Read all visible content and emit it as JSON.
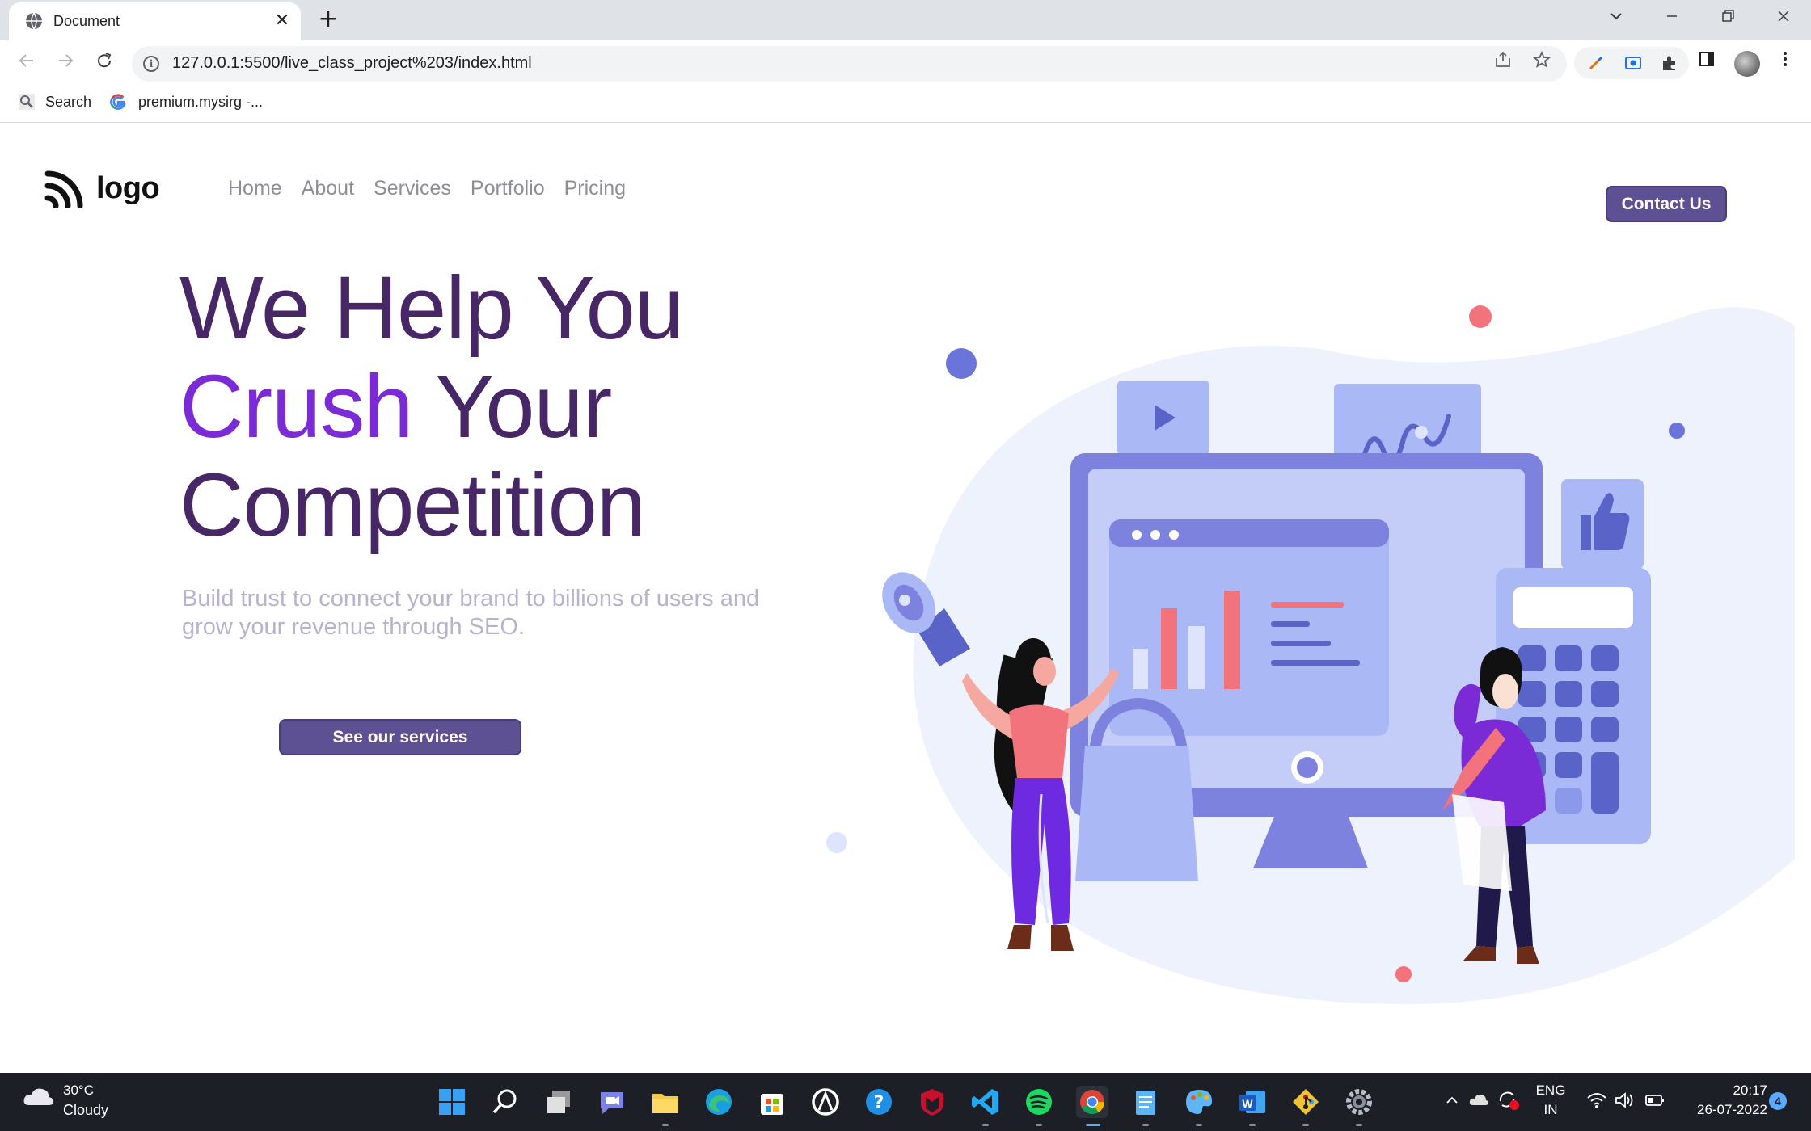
{
  "browser": {
    "tab_title": "Document",
    "tab_close": "✕",
    "new_tab": "+",
    "url": "127.0.0.1:5500/live_class_project%203/index.html",
    "bookmarks": [
      {
        "label": "Search",
        "icon": "search-icon"
      },
      {
        "label": "premium.mysirg -...",
        "icon": "google-icon"
      }
    ]
  },
  "page": {
    "logo_text": "logo",
    "nav": [
      "Home",
      "About",
      "Services",
      "Portfolio",
      "Pricing"
    ],
    "contact_label": "Contact Us",
    "hero": {
      "line1": "We Help You",
      "line2_accent": "Crush",
      "line2_rest": " Your",
      "line3": "Competition"
    },
    "subtitle": "Build trust to connect your brand to billions of users and grow your revenue through SEO.",
    "cta_label": "See our services",
    "colors": {
      "heading": "#472766",
      "accent": "#7a2bd6",
      "button": "#5e5193",
      "subtitle": "#b8b2cc",
      "nav": "#8d8d95"
    }
  },
  "taskbar": {
    "temperature": "30°C",
    "condition": "Cloudy",
    "language_line1": "ENG",
    "language_line2": "IN",
    "time": "20:17",
    "date": "26-07-2022",
    "notification_count": "4",
    "apps": [
      "windows-start-icon",
      "search-icon",
      "task-view-icon",
      "teams-chat-icon",
      "file-explorer-icon",
      "edge-icon",
      "store-icon",
      "app-icon",
      "help-icon",
      "mcafee-icon",
      "vscode-icon",
      "spotify-icon",
      "chrome-icon",
      "notepad-icon",
      "paint-icon",
      "word-icon",
      "git-icon",
      "settings-icon"
    ]
  }
}
